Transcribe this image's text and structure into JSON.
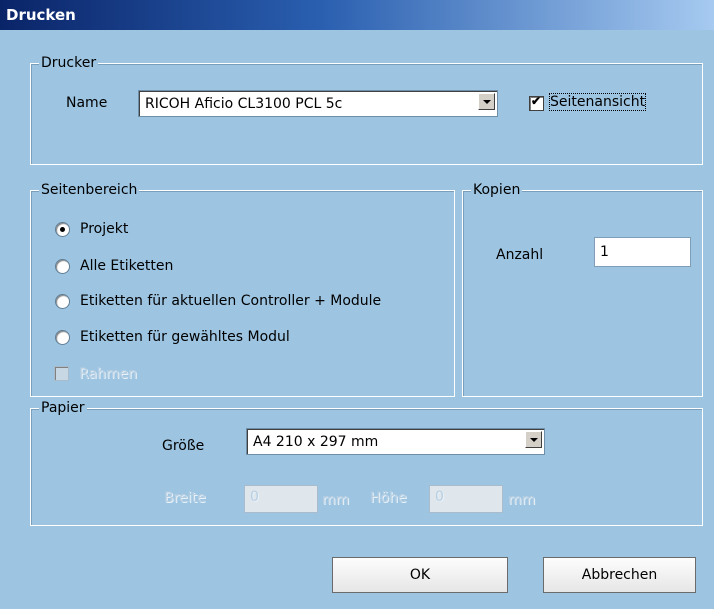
{
  "dialog": {
    "title": "Drucken"
  },
  "drucker": {
    "legend": "Drucker",
    "name_label": "Name",
    "printer_value": "RICOH Aficio CL3100 PCL 5c",
    "preview_label": "Seitenansicht",
    "preview_checked": true
  },
  "seitenbereich": {
    "legend": "Seitenbereich",
    "options": [
      {
        "label": "Projekt",
        "selected": true
      },
      {
        "label": "Alle Etiketten",
        "selected": false
      },
      {
        "label": "Etiketten für aktuellen Controller + Module",
        "selected": false
      },
      {
        "label": "Etiketten für gewähltes Modul",
        "selected": false
      }
    ],
    "rahmen_label": "Rahmen"
  },
  "kopien": {
    "legend": "Kopien",
    "anzahl_label": "Anzahl",
    "anzahl_value": "1"
  },
  "papier": {
    "legend": "Papier",
    "groesse_label": "Größe",
    "groesse_value": "A4 210 x 297 mm",
    "breite_label": "Breite",
    "breite_value": "0",
    "hoehe_label": "Höhe",
    "hoehe_value": "0",
    "unit_mm": "mm"
  },
  "buttons": {
    "ok": "OK",
    "cancel": "Abbrechen"
  }
}
